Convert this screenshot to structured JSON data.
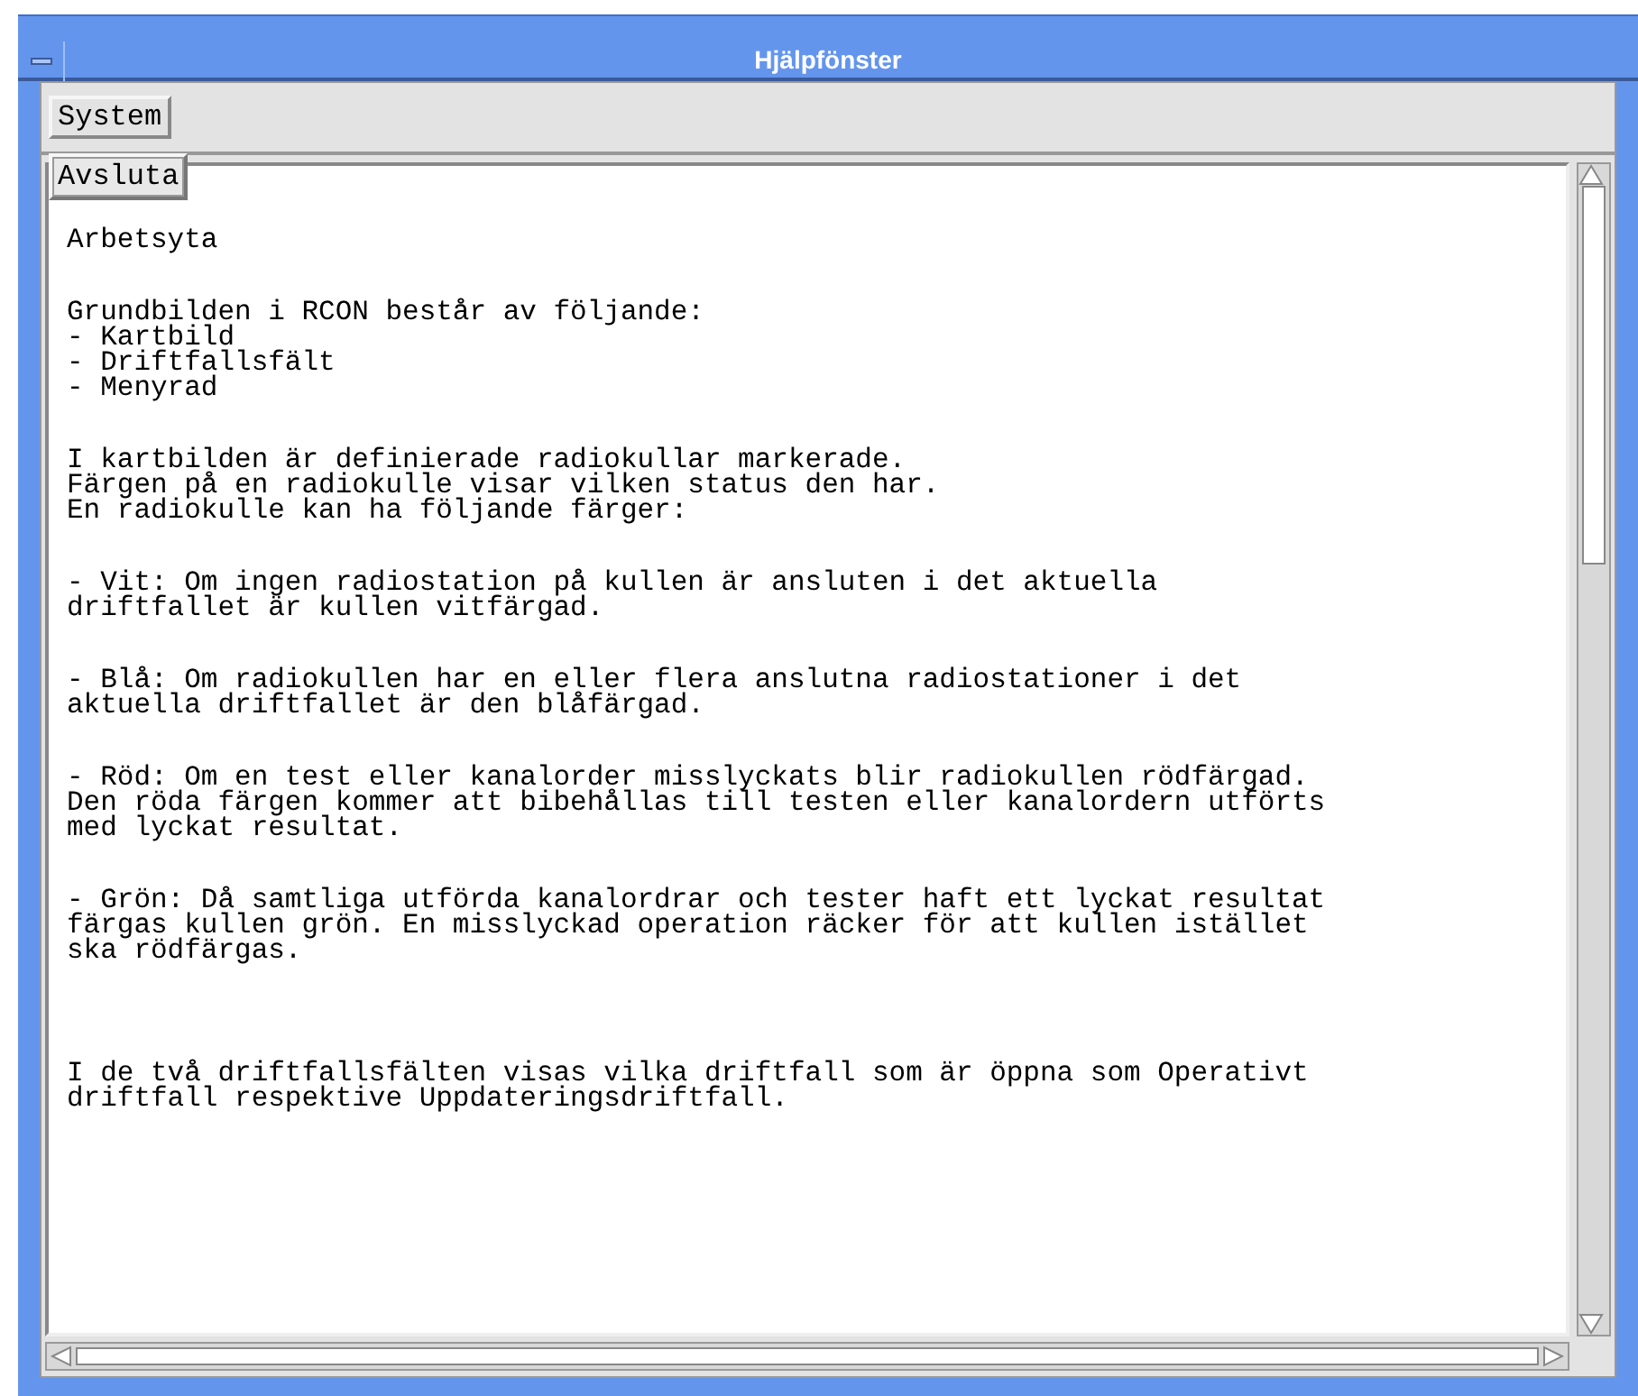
{
  "window": {
    "title": "Hjälpfönster"
  },
  "menu_bar": {
    "items": [
      {
        "label": "System",
        "expanded": true
      }
    ]
  },
  "open_menu": {
    "items": [
      {
        "label": "Avsluta",
        "selected": true
      }
    ]
  },
  "help_text": {
    "paragraphs": [
      {
        "kind": "text",
        "text": "Arbetsyta"
      },
      {
        "kind": "text",
        "text": "Grundbilden i RCON består av följande:\n- Kartbild\n- Driftfallsfält\n- Menyrad"
      },
      {
        "kind": "text",
        "text": "I kartbilden är definierade radiokullar markerade.\nFärgen på en radiokulle visar vilken status den har.\nEn radiokulle kan ha följande färger:"
      },
      {
        "kind": "text",
        "text": "- Vit: Om ingen radiostation på kullen är ansluten i det aktuella\ndriftfallet är kullen vitfärgad."
      },
      {
        "kind": "text",
        "text": "- Blå: Om radiokullen har en eller flera anslutna radiostationer i det\naktuella driftfallet är den blåfärgad."
      },
      {
        "kind": "text",
        "text": "- Röd: Om en test eller kanalorder misslyckats blir radiokullen rödfärgad.\nDen röda färgen kommer att bibehållas till testen eller kanalordern utförts\nmed lyckat resultat."
      },
      {
        "kind": "text",
        "text": "- Grön: Då samtliga utförda kanalordrar och tester haft ett lyckat resultat\nfärgas kullen grön. En misslyckad operation räcker för att kullen istället\nska rödfärgas."
      },
      {
        "kind": "spaced",
        "text": "I de två driftfallsfälten visas vilka driftfall som är öppna som Operativt\ndriftfall respektive Uppdateringsdriftfall."
      }
    ]
  }
}
